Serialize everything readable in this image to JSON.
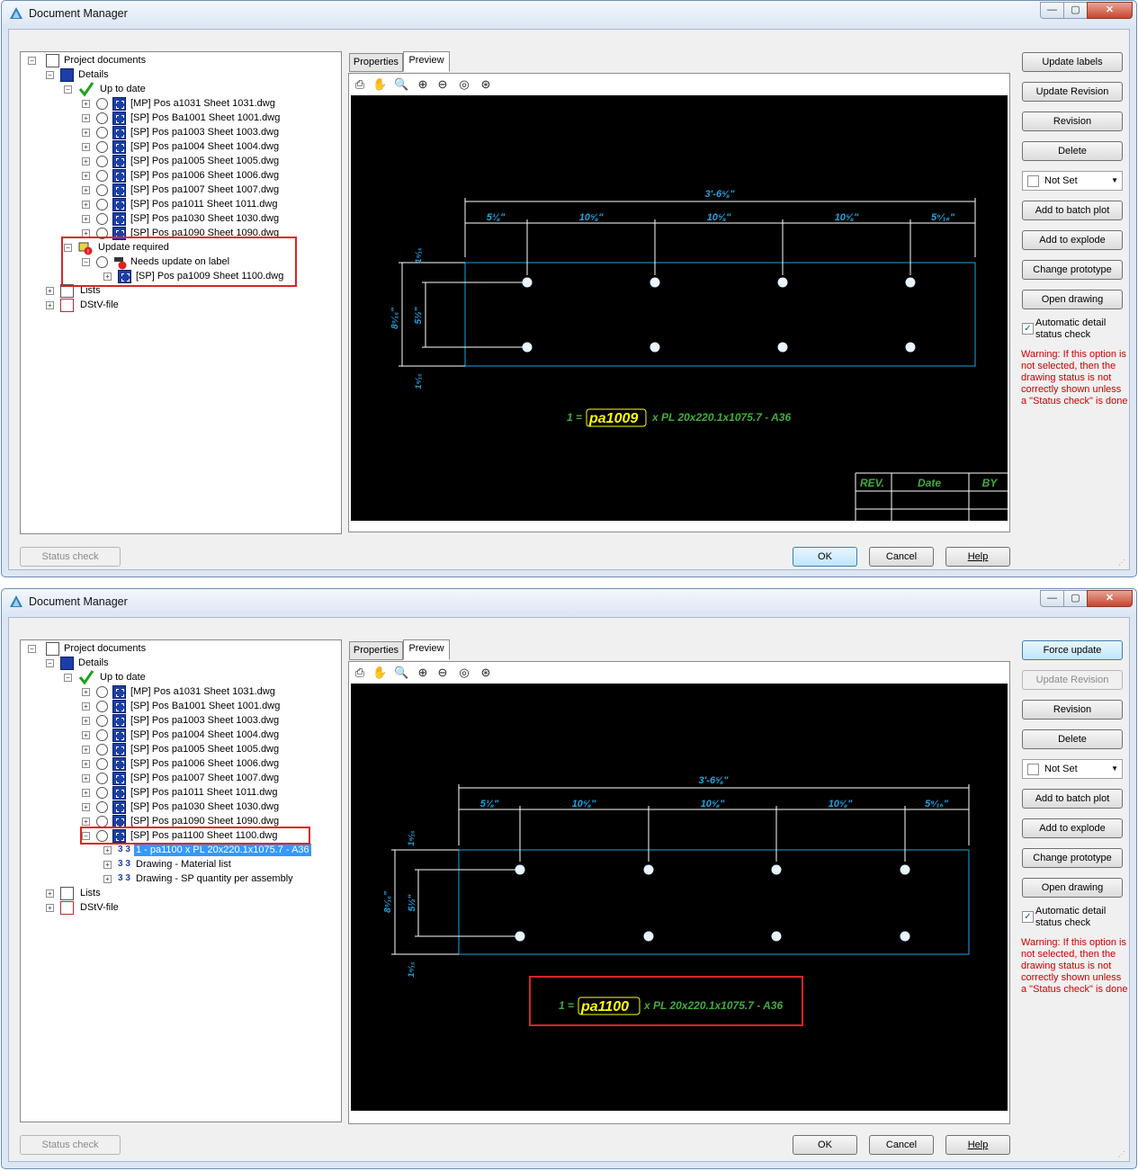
{
  "window1": {
    "title": "Document Manager",
    "window_controls": {
      "minimize": "—",
      "maximize": "▢",
      "close": "✕"
    },
    "tree": {
      "root": "Project documents",
      "details": "Details",
      "up_to_date": "Up to date",
      "files": [
        "[MP] Pos a1031 Sheet 1031.dwg",
        "[SP] Pos Ba1001 Sheet 1001.dwg",
        "[SP] Pos pa1003 Sheet 1003.dwg",
        "[SP] Pos pa1004 Sheet 1004.dwg",
        "[SP] Pos pa1005 Sheet 1005.dwg",
        "[SP] Pos pa1006 Sheet 1006.dwg",
        "[SP] Pos pa1007 Sheet 1007.dwg",
        "[SP] Pos pa1011 Sheet 1011.dwg",
        "[SP] Pos pa1030 Sheet 1030.dwg",
        "[SP] Pos pa1090 Sheet 1090.dwg"
      ],
      "update_required": "Update required",
      "needs_update": "Needs update on label",
      "needs_update_file": "[SP] Pos pa1009 Sheet 1100.dwg",
      "lists": "Lists",
      "dstv": "DStV-file"
    },
    "tabs": [
      "Properties",
      "Preview"
    ],
    "drawing": {
      "overall_dim": "3'-6⅝\"",
      "dims": [
        "5⅛\"",
        "10⅝\"",
        "10⅝\"",
        "10⅝\"",
        "5⁹⁄₁₆\""
      ],
      "height_dim": "8⁹⁄₁₆\"",
      "inner_dim": "5½\"",
      "top_dim": "1⁹⁄₁₆",
      "bottom_dim": "1⁹⁄₁₆",
      "label_prefix": "1 =",
      "label_pos": "pa1009",
      "label_suffix": "x PL 20x220.1x1075.7 - A36",
      "rev_headers": [
        "REV.",
        "Date",
        "BY"
      ]
    },
    "buttons": [
      "Update labels",
      "Update Revision",
      "Revision",
      "Delete"
    ],
    "combo_value": "Not Set",
    "buttons2": [
      "Add to batch plot",
      "Add to explode",
      "Change prototype",
      "Open drawing"
    ],
    "checkbox_label": "Automatic detail status check",
    "warning": "Warning: If this option is not selected, then the drawing status is not correctly shown unless a \"Status check\" is done",
    "status_check": "Status check",
    "ok": "OK",
    "cancel": "Cancel",
    "help": "Help"
  },
  "window2": {
    "title": "Document Manager",
    "window_controls": {
      "minimize": "—",
      "maximize": "▢",
      "close": "✕"
    },
    "tree": {
      "root": "Project documents",
      "details": "Details",
      "up_to_date": "Up to date",
      "files": [
        "[MP] Pos a1031 Sheet 1031.dwg",
        "[SP] Pos Ba1001 Sheet 1001.dwg",
        "[SP] Pos pa1003 Sheet 1003.dwg",
        "[SP] Pos pa1004 Sheet 1004.dwg",
        "[SP] Pos pa1005 Sheet 1005.dwg",
        "[SP] Pos pa1006 Sheet 1006.dwg",
        "[SP] Pos pa1007 Sheet 1007.dwg",
        "[SP] Pos pa1011 Sheet 1011.dwg",
        "[SP] Pos pa1030 Sheet 1030.dwg",
        "[SP] Pos pa1090 Sheet 1090.dwg",
        "[SP] Pos pa1100 Sheet 1100.dwg"
      ],
      "sub_items": [
        "1 - pa1100 x PL 20x220.1x1075.7 - A36",
        "Drawing - Material list",
        "Drawing - SP quantity per assembly"
      ],
      "lists": "Lists",
      "dstv": "DStV-file"
    },
    "tabs": [
      "Properties",
      "Preview"
    ],
    "drawing": {
      "overall_dim": "3'-6⅝\"",
      "dims": [
        "5⅛\"",
        "10⅝\"",
        "10⅝\"",
        "10⅝\"",
        "5⁹⁄₁₆\""
      ],
      "height_dim": "8⁹⁄₁₆\"",
      "inner_dim": "5½\"",
      "top_dim": "1⁹⁄₁₆",
      "bottom_dim": "1⁹⁄₁₆",
      "label_prefix": "1 =",
      "label_pos": "pa1100",
      "label_suffix": "x PL 20x220.1x1075.7 - A36"
    },
    "buttons": [
      "Force update",
      "Update Revision",
      "Revision",
      "Delete"
    ],
    "combo_value": "Not Set",
    "buttons2": [
      "Add to batch plot",
      "Add to explode",
      "Change prototype",
      "Open drawing"
    ],
    "checkbox_label": "Automatic detail status check",
    "warning": "Warning: If this option is not selected, then the drawing status is not correctly shown unless a \"Status check\" is done",
    "status_check": "Status check",
    "ok": "OK",
    "cancel": "Cancel",
    "help": "Help"
  },
  "colors": {
    "dim_cyan": "#1fa3e0",
    "label_green": "#3fae3a",
    "label_yellow": "#ffff00",
    "highlight_red": "#d92525",
    "selection_blue": "#3399ff"
  }
}
